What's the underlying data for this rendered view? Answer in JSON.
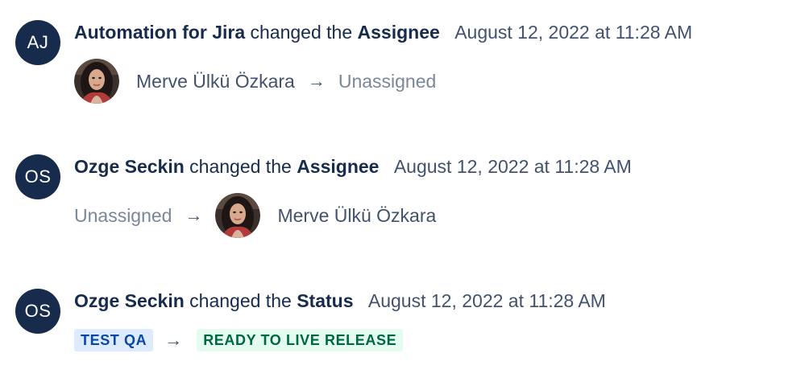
{
  "history": [
    {
      "avatar_initials": "AJ",
      "actor": "Automation for Jira",
      "verb": "changed the",
      "field": "Assignee",
      "timestamp": "August 12, 2022 at 11:28 AM",
      "from": "Merve Ülkü Özkara",
      "to": "Unassigned"
    },
    {
      "avatar_initials": "OS",
      "actor": "Ozge Seckin",
      "verb": "changed the",
      "field": "Assignee",
      "timestamp": "August 12, 2022 at 11:28 AM",
      "from": "Unassigned",
      "to": "Merve Ülkü Özkara"
    },
    {
      "avatar_initials": "OS",
      "actor": "Ozge Seckin",
      "verb": "changed the",
      "field": "Status",
      "timestamp": "August 12, 2022 at 11:28 AM",
      "from": "TEST QA",
      "to": "READY TO LIVE RELEASE"
    }
  ],
  "arrow_glyph": "→",
  "colors": {
    "avatar_bg": "#172b4d",
    "status_from_bg": "#deebff",
    "status_from_text": "#0747a6",
    "status_to_bg": "#e3fcef",
    "status_to_text": "#006644"
  },
  "icons": {
    "arrow": "arrow-right-icon",
    "user_photo": "user-photo-avatar"
  }
}
